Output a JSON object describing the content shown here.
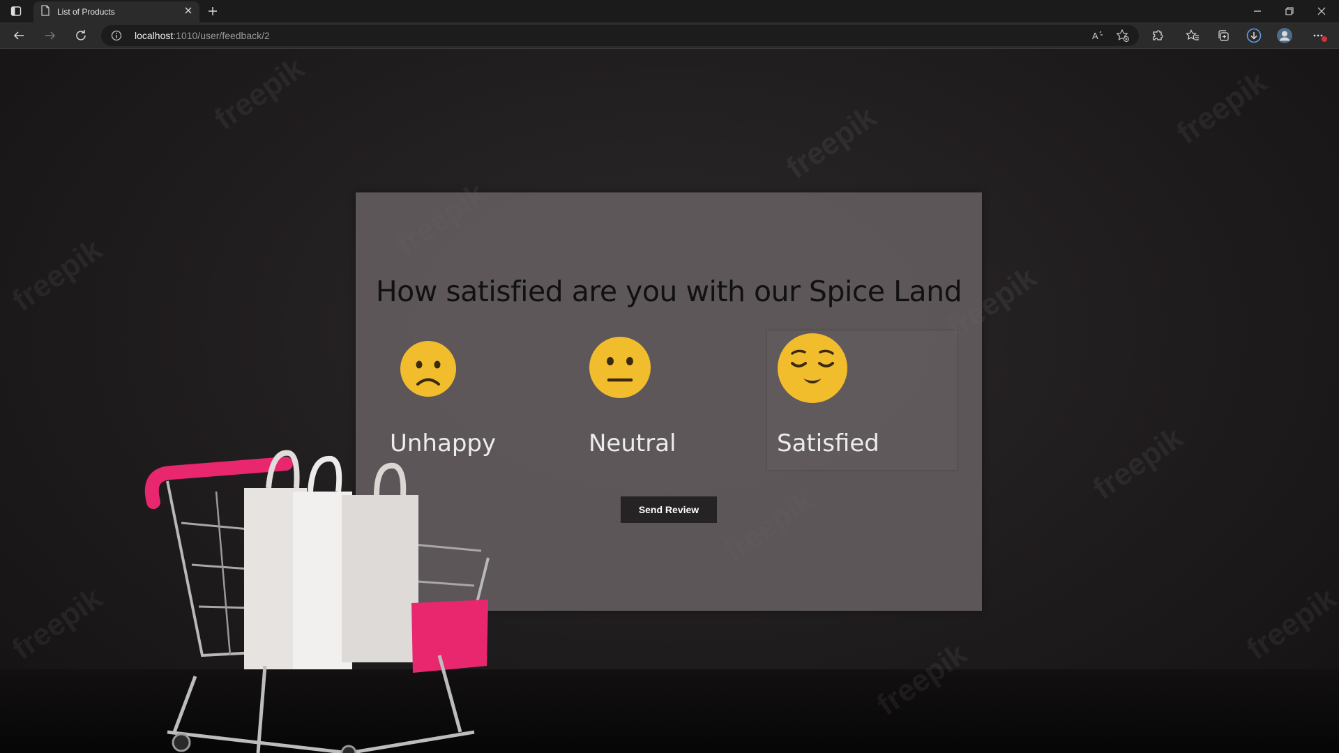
{
  "browser": {
    "tab_title": "List of Products",
    "address_host": "localhost",
    "address_path": ":1010/user/feedback/2",
    "icons": [
      "sidebar-icon",
      "page-icon",
      "close-icon",
      "plus-icon",
      "minimize-icon",
      "restore-icon",
      "window-close-icon",
      "back-icon",
      "forward-icon",
      "refresh-icon",
      "info-icon",
      "read-aloud-icon",
      "favorite-add-icon",
      "extensions-icon",
      "favorites-icon",
      "collections-icon",
      "download-icon",
      "profile-icon",
      "more-icon"
    ]
  },
  "page": {
    "question": "How satisfied are you with our Spice Land",
    "options": [
      {
        "label": "Unhappy",
        "icon": "sad-face-icon"
      },
      {
        "label": "Neutral",
        "icon": "neutral-face-icon"
      },
      {
        "label": "Satisfied",
        "icon": "relieved-face-icon"
      }
    ],
    "selected_option": "Satisfied",
    "submit_label": "Send Review",
    "watermark_text": "freepik",
    "colors": {
      "emoji": "#f2bd2c",
      "button": "#262324",
      "card": "#666062",
      "cart_accent": "#e8276e"
    }
  }
}
